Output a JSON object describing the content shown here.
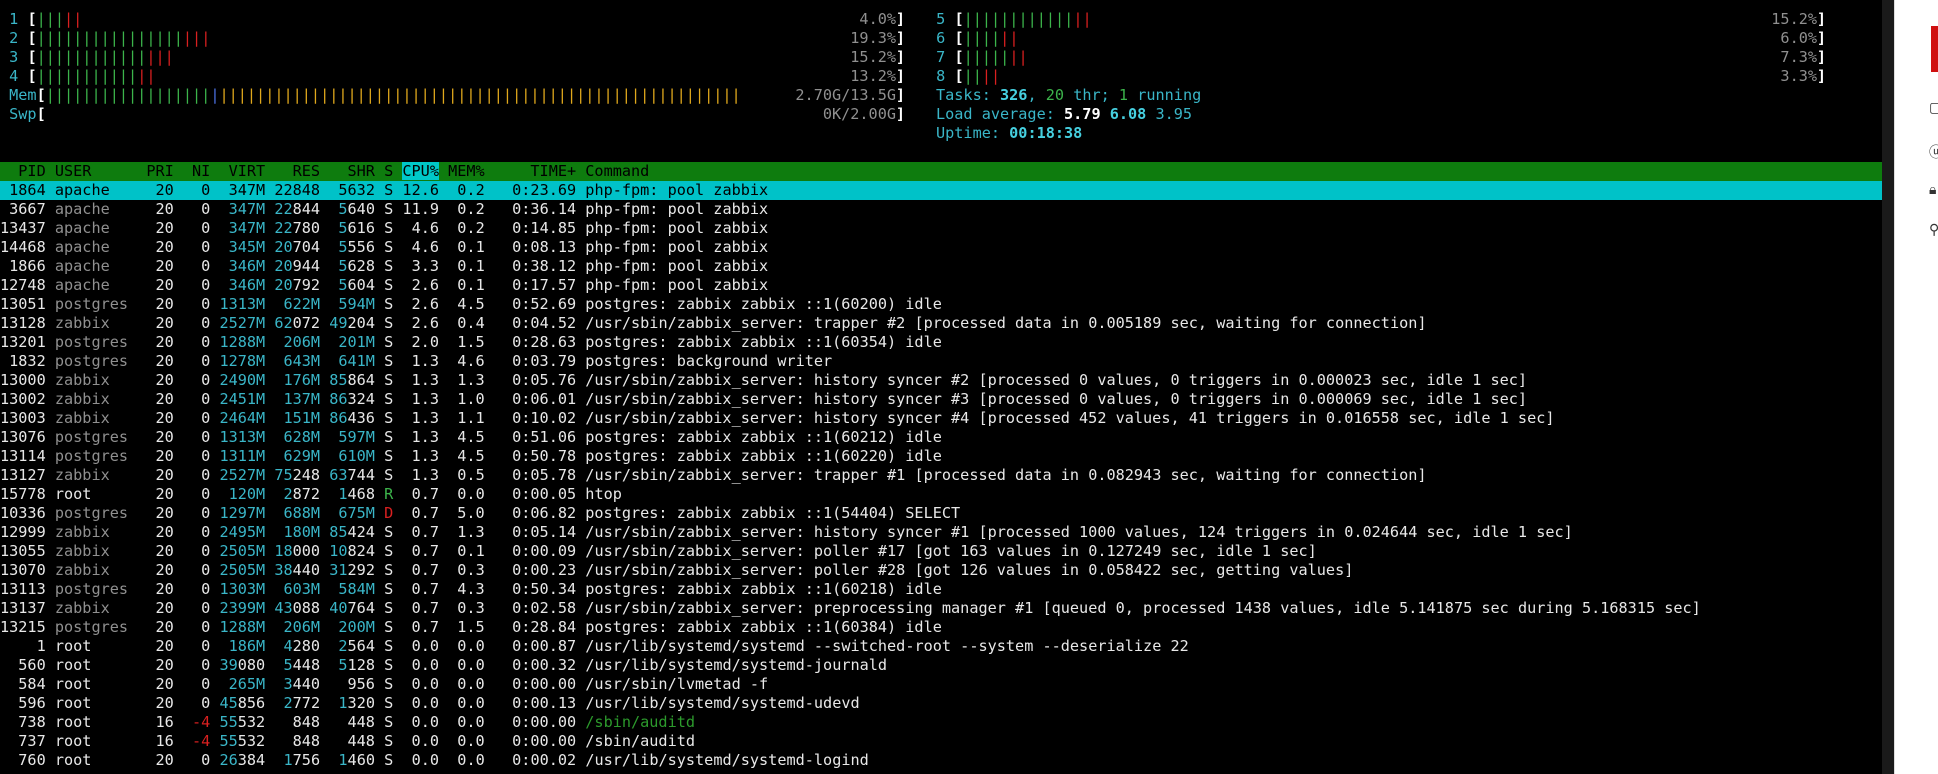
{
  "cpus": [
    {
      "id": "1",
      "value": "4.0%",
      "green": 3,
      "red": 2
    },
    {
      "id": "2",
      "value": "19.3%",
      "green": 16,
      "red": 3
    },
    {
      "id": "3",
      "value": "15.2%",
      "green": 12,
      "red": 3
    },
    {
      "id": "4",
      "value": "13.2%",
      "green": 11,
      "red": 2
    },
    {
      "id": "5",
      "value": "15.2%",
      "green": 12,
      "red": 2
    },
    {
      "id": "6",
      "value": "6.0%",
      "green": 4,
      "red": 2
    },
    {
      "id": "7",
      "value": "7.3%",
      "green": 5,
      "red": 2
    },
    {
      "id": "8",
      "value": "3.3%",
      "green": 2,
      "red": 2
    }
  ],
  "mem": {
    "label": "Mem",
    "value": "2.70G/13.5G",
    "green": 18,
    "blue": 1,
    "yellow": 57
  },
  "swp": {
    "label": "Swp",
    "value": "0K/2.00G"
  },
  "tasks": {
    "label": "Tasks:",
    "count": "326",
    "thr": "20",
    "thr_label": "thr;",
    "running": "1",
    "running_label": "running"
  },
  "load": {
    "label": "Load average:",
    "l1": "5.79",
    "l5": "6.08",
    "l15": "3.95"
  },
  "uptime": {
    "label": "Uptime:",
    "value": "00:18:38"
  },
  "header": {
    "pid": "PID",
    "user": "USER",
    "pri": "PRI",
    "ni": "NI",
    "virt": "VIRT",
    "res": "RES",
    "shr": "SHR",
    "s": "S",
    "cpu": "CPU%",
    "mem": "MEM%",
    "time": "TIME+",
    "command": "Command"
  },
  "processes": [
    {
      "pid": "1864",
      "user": "apache",
      "pri": "20",
      "ni": "0",
      "virt": "347M",
      "res": "22848",
      "shr": "5632",
      "s": "S",
      "cpu": "12.6",
      "mem": "0.2",
      "time": "0:23.69",
      "cmd": "php-fpm: pool zabbix",
      "selected": true
    },
    {
      "pid": "3667",
      "user": "apache",
      "pri": "20",
      "ni": "0",
      "virt": "347M",
      "res": "22844",
      "shr": "5640",
      "s": "S",
      "cpu": "11.9",
      "mem": "0.2",
      "time": "0:36.14",
      "cmd": "php-fpm: pool zabbix"
    },
    {
      "pid": "13437",
      "user": "apache",
      "pri": "20",
      "ni": "0",
      "virt": "347M",
      "res": "22780",
      "shr": "5616",
      "s": "S",
      "cpu": "4.6",
      "mem": "0.2",
      "time": "0:14.85",
      "cmd": "php-fpm: pool zabbix"
    },
    {
      "pid": "14468",
      "user": "apache",
      "pri": "20",
      "ni": "0",
      "virt": "345M",
      "res": "20704",
      "shr": "5556",
      "s": "S",
      "cpu": "4.6",
      "mem": "0.1",
      "time": "0:08.13",
      "cmd": "php-fpm: pool zabbix"
    },
    {
      "pid": "1866",
      "user": "apache",
      "pri": "20",
      "ni": "0",
      "virt": "346M",
      "res": "20944",
      "shr": "5628",
      "s": "S",
      "cpu": "3.3",
      "mem": "0.1",
      "time": "0:38.12",
      "cmd": "php-fpm: pool zabbix"
    },
    {
      "pid": "12748",
      "user": "apache",
      "pri": "20",
      "ni": "0",
      "virt": "346M",
      "res": "20792",
      "shr": "5604",
      "s": "S",
      "cpu": "2.6",
      "mem": "0.1",
      "time": "0:17.57",
      "cmd": "php-fpm: pool zabbix"
    },
    {
      "pid": "13051",
      "user": "postgres",
      "pri": "20",
      "ni": "0",
      "virt": "1313M",
      "res": "622M",
      "shr": "594M",
      "s": "S",
      "cpu": "2.6",
      "mem": "4.5",
      "time": "0:52.69",
      "cmd": "postgres: zabbix zabbix ::1(60200) idle"
    },
    {
      "pid": "13128",
      "user": "zabbix",
      "pri": "20",
      "ni": "0",
      "virt": "2527M",
      "res": "62072",
      "shr": "49204",
      "s": "S",
      "cpu": "2.6",
      "mem": "0.4",
      "time": "0:04.52",
      "cmd": "/usr/sbin/zabbix_server: trapper #2 [processed data in 0.005189 sec, waiting for connection]"
    },
    {
      "pid": "13201",
      "user": "postgres",
      "pri": "20",
      "ni": "0",
      "virt": "1288M",
      "res": "206M",
      "shr": "201M",
      "s": "S",
      "cpu": "2.0",
      "mem": "1.5",
      "time": "0:28.63",
      "cmd": "postgres: zabbix zabbix ::1(60354) idle"
    },
    {
      "pid": "1832",
      "user": "postgres",
      "pri": "20",
      "ni": "0",
      "virt": "1278M",
      "res": "643M",
      "shr": "641M",
      "s": "S",
      "cpu": "1.3",
      "mem": "4.6",
      "time": "0:03.79",
      "cmd": "postgres: background writer"
    },
    {
      "pid": "13000",
      "user": "zabbix",
      "pri": "20",
      "ni": "0",
      "virt": "2490M",
      "res": "176M",
      "shr": "85864",
      "s": "S",
      "cpu": "1.3",
      "mem": "1.3",
      "time": "0:05.76",
      "cmd": "/usr/sbin/zabbix_server: history syncer #2 [processed 0 values, 0 triggers in 0.000023 sec, idle 1 sec]"
    },
    {
      "pid": "13002",
      "user": "zabbix",
      "pri": "20",
      "ni": "0",
      "virt": "2451M",
      "res": "137M",
      "shr": "86324",
      "s": "S",
      "cpu": "1.3",
      "mem": "1.0",
      "time": "0:06.01",
      "cmd": "/usr/sbin/zabbix_server: history syncer #3 [processed 0 values, 0 triggers in 0.000069 sec, idle 1 sec]"
    },
    {
      "pid": "13003",
      "user": "zabbix",
      "pri": "20",
      "ni": "0",
      "virt": "2464M",
      "res": "151M",
      "shr": "86436",
      "s": "S",
      "cpu": "1.3",
      "mem": "1.1",
      "time": "0:10.02",
      "cmd": "/usr/sbin/zabbix_server: history syncer #4 [processed 452 values, 41 triggers in 0.016558 sec, idle 1 sec]"
    },
    {
      "pid": "13076",
      "user": "postgres",
      "pri": "20",
      "ni": "0",
      "virt": "1313M",
      "res": "628M",
      "shr": "597M",
      "s": "S",
      "cpu": "1.3",
      "mem": "4.5",
      "time": "0:51.06",
      "cmd": "postgres: zabbix zabbix ::1(60212) idle"
    },
    {
      "pid": "13114",
      "user": "postgres",
      "pri": "20",
      "ni": "0",
      "virt": "1311M",
      "res": "629M",
      "shr": "610M",
      "s": "S",
      "cpu": "1.3",
      "mem": "4.5",
      "time": "0:50.78",
      "cmd": "postgres: zabbix zabbix ::1(60220) idle"
    },
    {
      "pid": "13127",
      "user": "zabbix",
      "pri": "20",
      "ni": "0",
      "virt": "2527M",
      "res": "75248",
      "shr": "63744",
      "s": "S",
      "cpu": "1.3",
      "mem": "0.5",
      "time": "0:05.78",
      "cmd": "/usr/sbin/zabbix_server: trapper #1 [processed data in 0.082943 sec, waiting for connection]"
    },
    {
      "pid": "15778",
      "user": "root",
      "pri": "20",
      "ni": "0",
      "virt": "120M",
      "res": "2872",
      "shr": "1468",
      "s": "R",
      "cpu": "0.7",
      "mem": "0.0",
      "time": "0:00.05",
      "cmd": "htop"
    },
    {
      "pid": "10336",
      "user": "postgres",
      "pri": "20",
      "ni": "0",
      "virt": "1297M",
      "res": "688M",
      "shr": "675M",
      "s": "D",
      "cpu": "0.7",
      "mem": "5.0",
      "time": "0:06.82",
      "cmd": "postgres: zabbix zabbix ::1(54404) SELECT"
    },
    {
      "pid": "12999",
      "user": "zabbix",
      "pri": "20",
      "ni": "0",
      "virt": "2495M",
      "res": "180M",
      "shr": "85424",
      "s": "S",
      "cpu": "0.7",
      "mem": "1.3",
      "time": "0:05.14",
      "cmd": "/usr/sbin/zabbix_server: history syncer #1 [processed 1000 values, 124 triggers in 0.024644 sec, idle 1 sec]"
    },
    {
      "pid": "13055",
      "user": "zabbix",
      "pri": "20",
      "ni": "0",
      "virt": "2505M",
      "res": "18000",
      "shr": "10824",
      "s": "S",
      "cpu": "0.7",
      "mem": "0.1",
      "time": "0:00.09",
      "cmd": "/usr/sbin/zabbix_server: poller #17 [got 163 values in 0.127249 sec, idle 1 sec]"
    },
    {
      "pid": "13070",
      "user": "zabbix",
      "pri": "20",
      "ni": "0",
      "virt": "2505M",
      "res": "38440",
      "shr": "31292",
      "s": "S",
      "cpu": "0.7",
      "mem": "0.3",
      "time": "0:00.23",
      "cmd": "/usr/sbin/zabbix_server: poller #28 [got 126 values in 0.058422 sec, getting values]"
    },
    {
      "pid": "13113",
      "user": "postgres",
      "pri": "20",
      "ni": "0",
      "virt": "1303M",
      "res": "603M",
      "shr": "584M",
      "s": "S",
      "cpu": "0.7",
      "mem": "4.3",
      "time": "0:50.34",
      "cmd": "postgres: zabbix zabbix ::1(60218) idle"
    },
    {
      "pid": "13137",
      "user": "zabbix",
      "pri": "20",
      "ni": "0",
      "virt": "2399M",
      "res": "43088",
      "shr": "40764",
      "s": "S",
      "cpu": "0.7",
      "mem": "0.3",
      "time": "0:02.58",
      "cmd": "/usr/sbin/zabbix_server: preprocessing manager #1 [queued 0, processed 1438 values, idle 5.141875 sec during 5.168315 sec]"
    },
    {
      "pid": "13215",
      "user": "postgres",
      "pri": "20",
      "ni": "0",
      "virt": "1288M",
      "res": "206M",
      "shr": "200M",
      "s": "S",
      "cpu": "0.7",
      "mem": "1.5",
      "time": "0:28.84",
      "cmd": "postgres: zabbix zabbix ::1(60384) idle"
    },
    {
      "pid": "1",
      "user": "root",
      "pri": "20",
      "ni": "0",
      "virt": "186M",
      "res": "4280",
      "shr": "2564",
      "s": "S",
      "cpu": "0.0",
      "mem": "0.0",
      "time": "0:00.87",
      "cmd": "/usr/lib/systemd/systemd --switched-root --system --deserialize 22"
    },
    {
      "pid": "560",
      "user": "root",
      "pri": "20",
      "ni": "0",
      "virt": "39080",
      "res": "5448",
      "shr": "5128",
      "s": "S",
      "cpu": "0.0",
      "mem": "0.0",
      "time": "0:00.32",
      "cmd": "/usr/lib/systemd/systemd-journald"
    },
    {
      "pid": "584",
      "user": "root",
      "pri": "20",
      "ni": "0",
      "virt": "265M",
      "res": "3440",
      "shr": "956",
      "s": "S",
      "cpu": "0.0",
      "mem": "0.0",
      "time": "0:00.00",
      "cmd": "/usr/sbin/lvmetad -f"
    },
    {
      "pid": "596",
      "user": "root",
      "pri": "20",
      "ni": "0",
      "virt": "45856",
      "res": "2772",
      "shr": "1320",
      "s": "S",
      "cpu": "0.0",
      "mem": "0.0",
      "time": "0:00.13",
      "cmd": "/usr/lib/systemd/systemd-udevd"
    },
    {
      "pid": "738",
      "user": "root",
      "pri": "16",
      "ni": "-4",
      "virt": "55532",
      "res": "848",
      "shr": "448",
      "s": "S",
      "cpu": "0.0",
      "mem": "0.0",
      "time": "0:00.00",
      "cmd": "/sbin/auditd",
      "thread": true
    },
    {
      "pid": "737",
      "user": "root",
      "pri": "16",
      "ni": "-4",
      "virt": "55532",
      "res": "848",
      "shr": "448",
      "s": "S",
      "cpu": "0.0",
      "mem": "0.0",
      "time": "0:00.00",
      "cmd": "/sbin/auditd"
    },
    {
      "pid": "760",
      "user": "root",
      "pri": "20",
      "ni": "0",
      "virt": "26384",
      "res": "1756",
      "shr": "1460",
      "s": "S",
      "cpu": "0.0",
      "mem": "0.0",
      "time": "0:00.02",
      "cmd": "/usr/lib/systemd/systemd-logind"
    }
  ],
  "colors": {
    "header_bg": "#0e7c0e",
    "selected_bg": "#00c2c8",
    "cyan": "#3ab6c8",
    "green": "#3cb44b",
    "red": "#d92020",
    "yellow": "#e0a81c"
  },
  "side_panel": {
    "icons": [
      "panel-tab-icon",
      "panel-link-icon",
      "panel-lock-icon",
      "panel-pin-icon"
    ]
  }
}
